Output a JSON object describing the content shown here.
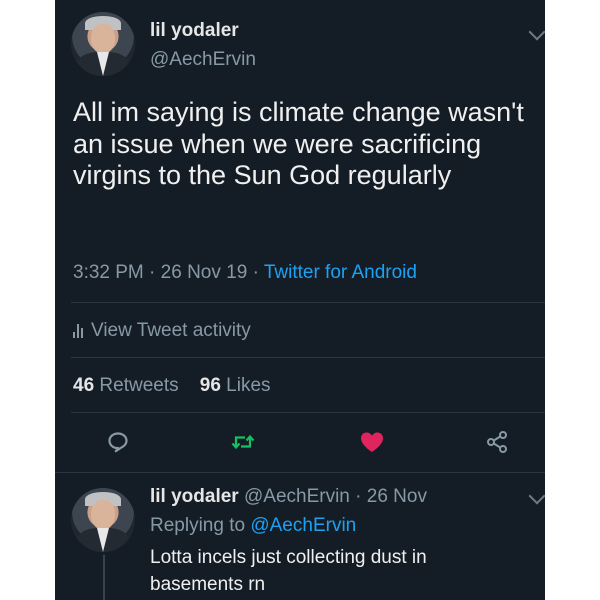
{
  "tweet": {
    "author_name": "lil yodaler",
    "author_handle": "@AechErvin",
    "text": "All im saying is climate change wasn't an issue when we were sacrificing virgins to the Sun God regularly",
    "time": "3:32 PM",
    "date": "26 Nov 19",
    "source": "Twitter for Android",
    "activity_label": "View Tweet activity",
    "retweets_count": "46",
    "retweets_label": "Retweets",
    "likes_count": "96",
    "likes_label": "Likes",
    "liked": true
  },
  "actions": {
    "reply_icon": "reply-icon",
    "retweet_icon": "retweet-icon",
    "like_icon": "heart-icon",
    "share_icon": "share-icon"
  },
  "reply": {
    "author_name": "lil yodaler",
    "author_handle": "@AechErvin",
    "date": "26 Nov",
    "replying_to_label": "Replying to",
    "replying_to_handle": "@AechErvin",
    "text_line1": "Lotta incels just collecting dust in",
    "text_line2": "basements rn"
  },
  "colors": {
    "background": "#141d26",
    "link": "#1da1f2",
    "retweet": "#17bf63",
    "like": "#e0245e",
    "muted": "#8899a6",
    "text": "#f0f0f0"
  }
}
